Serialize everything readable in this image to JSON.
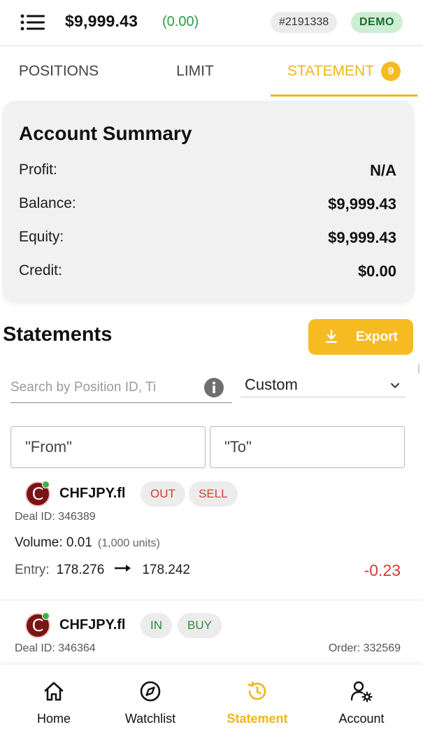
{
  "header": {
    "balance": "$9,999.43",
    "balance_change": "(0.00)",
    "account_number": "#2191338",
    "mode_badge": "DEMO"
  },
  "tabs": [
    {
      "label": "POSITIONS"
    },
    {
      "label": "LIMIT"
    },
    {
      "label": "STATEMENT",
      "badge": "9",
      "active": true
    }
  ],
  "summary": {
    "title": "Account Summary",
    "rows": [
      {
        "label": "Profit:",
        "value": "N/A"
      },
      {
        "label": "Balance:",
        "value": "$9,999.43"
      },
      {
        "label": "Equity:",
        "value": "$9,999.43"
      },
      {
        "label": "Credit:",
        "value": "$0.00"
      }
    ]
  },
  "statements": {
    "title": "Statements",
    "export_label": "Export",
    "search_placeholder": "Search by Position ID, Ti",
    "range_value": "Custom",
    "from_placeholder": "\"From\"",
    "to_placeholder": "\"To\""
  },
  "deals": [
    {
      "coin_letter": "C",
      "symbol": "CHFJPY.fl",
      "direction": "OUT",
      "side": "SELL",
      "deal_id": "Deal ID: 346389",
      "volume_label": "Volume: 0.01",
      "units": "(1,000 units)",
      "entry_label": "Entry:",
      "entry_open": "178.276",
      "entry_close": "178.242",
      "pnl": "-0.23"
    },
    {
      "coin_letter": "C",
      "symbol": "CHFJPY.fl",
      "direction": "IN",
      "side": "BUY",
      "deal_id": "Deal ID: 346364",
      "order_id": "Order: 332569"
    }
  ],
  "nav": [
    {
      "label": "Home",
      "icon": "home-icon"
    },
    {
      "label": "Watchlist",
      "icon": "compass-icon"
    },
    {
      "label": "Statement",
      "icon": "history-icon",
      "active": true
    },
    {
      "label": "Account",
      "icon": "user-settings-icon"
    }
  ],
  "colors": {
    "accent": "#f6bb22",
    "positive": "#2e9d45",
    "negative": "#d33b36",
    "demo_badge_bg": "#cdeed4"
  }
}
